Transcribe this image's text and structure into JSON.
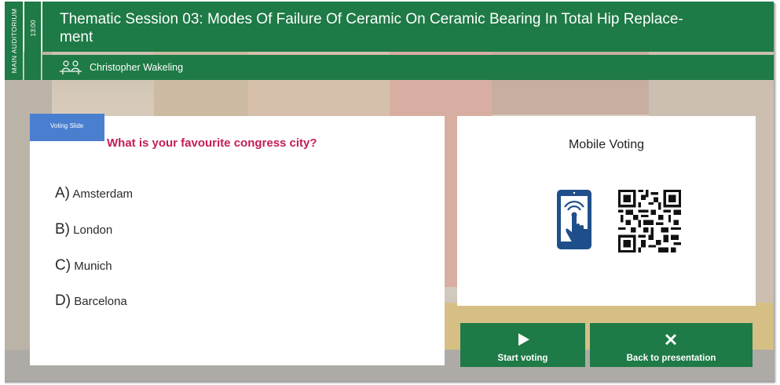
{
  "header": {
    "room": "MAIN AUDITORIUM",
    "time": "13:00",
    "title": "Thematic Session 03: Modes Of Failure Of Ceramic On Ceramic Bearing In Total Hip Replace-\nment",
    "speaker": "Christopher Wakeling"
  },
  "slide": {
    "tag": "Voting Slide",
    "question": "What is your favourite congress city?",
    "options": [
      {
        "letter": "A)",
        "text": "Amsterdam"
      },
      {
        "letter": "B)",
        "text": "London"
      },
      {
        "letter": "C)",
        "text": "Munich"
      },
      {
        "letter": "D)",
        "text": "Barcelona"
      }
    ]
  },
  "mobile": {
    "title": "Mobile Voting",
    "icons": [
      "phone-tap-icon",
      "qr-code-icon"
    ]
  },
  "actions": {
    "start_label": "Start voting",
    "start_icon": "play-icon",
    "back_label": "Back to presentation",
    "back_icon": "close-icon"
  },
  "colors": {
    "brand_green": "#1e7a46",
    "question_red": "#c41e52",
    "tag_blue": "#4a7fd0",
    "phone_blue": "#1f4f8a"
  }
}
